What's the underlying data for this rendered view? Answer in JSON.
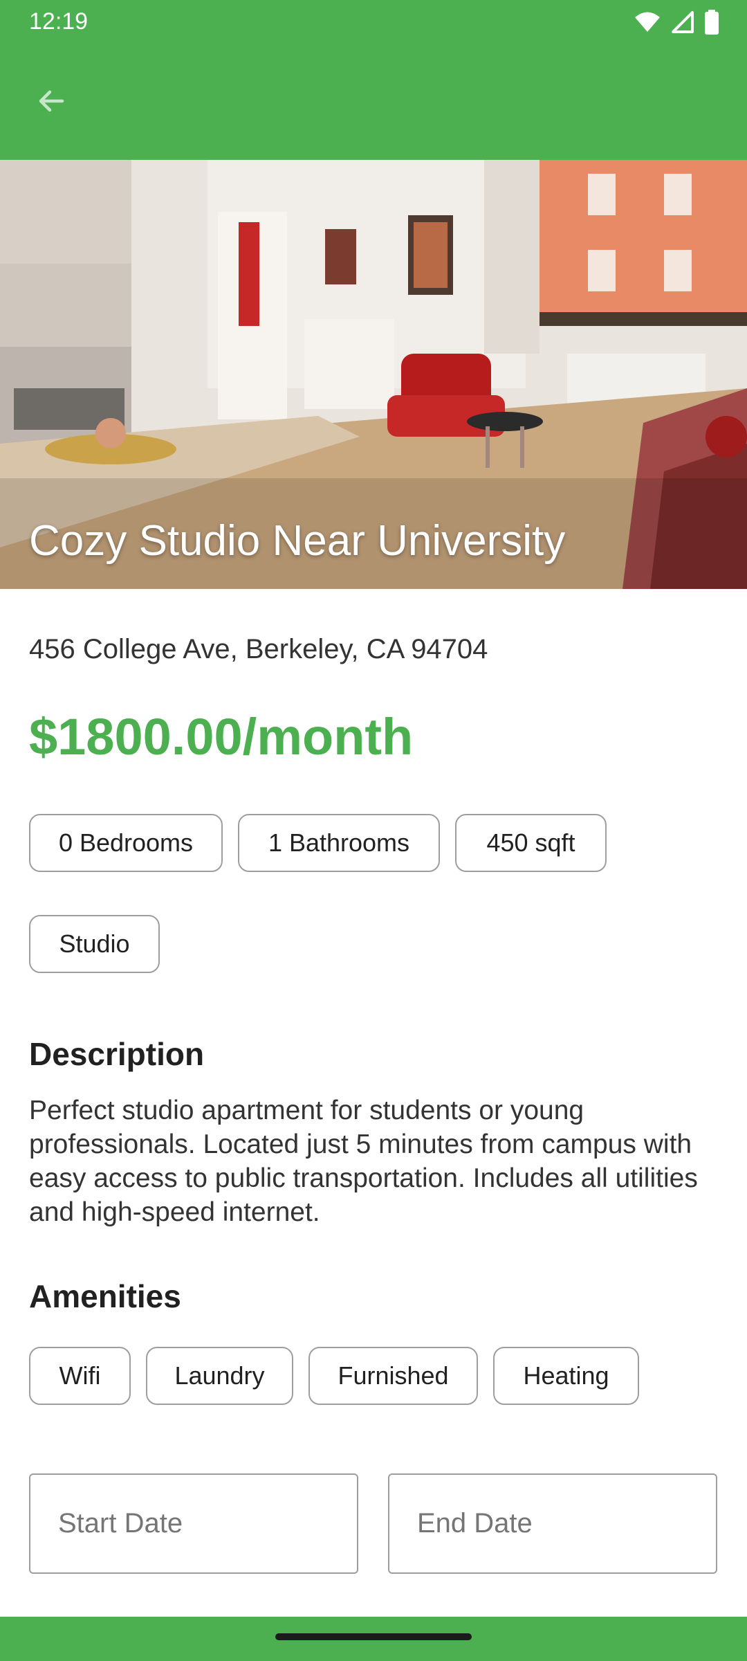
{
  "status_bar": {
    "time": "12:19"
  },
  "listing": {
    "title": "Cozy Studio Near University",
    "address": "456 College Ave, Berkeley, CA 94704",
    "price": "$1800.00/month",
    "chips": [
      "0 Bedrooms",
      "1 Bathrooms",
      "450 sqft"
    ],
    "type": "Studio"
  },
  "description": {
    "heading": "Description",
    "text": "Perfect studio apartment for students or young professionals. Located just 5 minutes from campus with easy access to public transportation. Includes all utilities and high-speed internet."
  },
  "amenities": {
    "heading": "Amenities",
    "items": [
      "Wifi",
      "Laundry",
      "Furnished",
      "Heating"
    ]
  },
  "booking": {
    "start_placeholder": "Start Date",
    "end_placeholder": "End Date"
  },
  "colors": {
    "accent": "#4caf50"
  },
  "icons": {
    "back": "arrow-left-icon",
    "wifi": "wifi-icon",
    "signal": "signal-icon",
    "battery": "battery-icon"
  }
}
